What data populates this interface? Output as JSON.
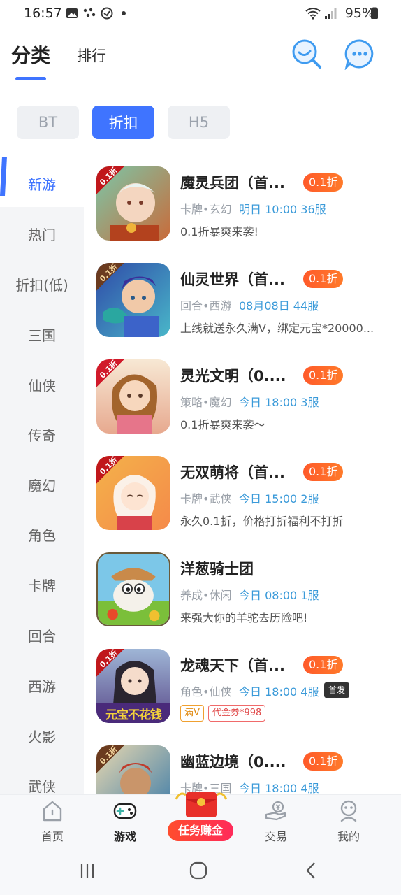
{
  "status_bar": {
    "time": "16:57",
    "battery": "95%"
  },
  "header": {
    "tab_active": "分类",
    "tab_inactive": "排行",
    "icons": [
      "search-icon",
      "message-icon"
    ]
  },
  "filter_chips": [
    {
      "label": "BT",
      "active": false
    },
    {
      "label": "折扣",
      "active": true
    },
    {
      "label": "H5",
      "active": false
    }
  ],
  "sidebar": {
    "items": [
      "新游",
      "热门",
      "折扣(低)",
      "三国",
      "仙侠",
      "传奇",
      "魔幻",
      "角色",
      "卡牌",
      "回合",
      "西游",
      "火影",
      "武侠"
    ],
    "active_index": 0
  },
  "games": [
    {
      "name": "魔灵兵团（首...",
      "discount": "0.1折",
      "tags": "卡牌•玄幻",
      "schedule": "明日 10:00 36服",
      "desc": "0.1折暴爽来袭!",
      "icon_text": "0.1折"
    },
    {
      "name": "仙灵世界（首...",
      "discount": "0.1折",
      "tags": "回合•西游",
      "schedule": "08月08日 44服",
      "desc": "上线就送永久满V，绑定元宝*20000...",
      "icon_text": "0.1折"
    },
    {
      "name": "灵光文明（0....",
      "discount": "0.1折",
      "tags": "策略•魔幻",
      "schedule": "今日 18:00 3服",
      "desc": "0.1折暴爽来袭～",
      "icon_text": "0.1折"
    },
    {
      "name": "无双萌将（首...",
      "discount": "0.1折",
      "tags": "卡牌•武侠",
      "schedule": "今日 15:00 2服",
      "desc": "永久0.1折，价格打折福利不打折",
      "icon_text": "0.1折"
    },
    {
      "name": "洋葱骑士团",
      "discount": "",
      "tags": "养成•休闲",
      "schedule": "今日 08:00 1服",
      "desc": "来强大你的羊驼去历险吧!",
      "icon_text": ""
    },
    {
      "name": "龙魂天下（首...",
      "discount": "0.1折",
      "tags": "角色•仙侠",
      "schedule": "今日 18:00 4服",
      "first_release": "首发",
      "badges": [
        "满V",
        "代金券*998"
      ],
      "icon_text": "0.1折",
      "icon_banner": "元宝不花钱"
    },
    {
      "name": "幽蓝边境（0....",
      "discount": "0.1折",
      "tags": "卡牌•三国",
      "schedule": "今日 18:00 4服",
      "desc": "",
      "icon_text": "0.1折"
    }
  ],
  "tabbar": {
    "items": [
      {
        "label": "首页",
        "icon": "home-icon"
      },
      {
        "label": "游戏",
        "icon": "gamepad-icon"
      },
      {
        "label": "任务赚金",
        "icon": "red-envelope-icon"
      },
      {
        "label": "交易",
        "icon": "trade-icon"
      },
      {
        "label": "我的",
        "icon": "profile-icon"
      }
    ],
    "active_index": 1
  },
  "colors": {
    "accent": "#3f74ff",
    "discount": "#ff5a2a",
    "schedule": "#3a9ad9"
  }
}
